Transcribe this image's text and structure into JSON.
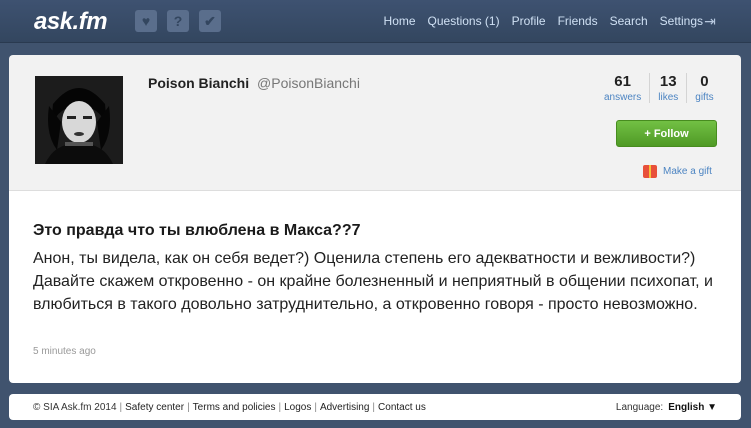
{
  "header": {
    "logo_text": "ask.fm",
    "icons": [
      "heart-icon",
      "question-icon",
      "check-icon"
    ],
    "nav": [
      "Home",
      "Questions (1)",
      "Profile",
      "Friends",
      "Search",
      "Settings"
    ],
    "logout_icon": "logout-icon"
  },
  "profile": {
    "name": "Poison Bianchi",
    "handle": "@PoisonBianchi",
    "stats": {
      "answers": {
        "value": "61",
        "label": "answers"
      },
      "likes": {
        "value": "13",
        "label": "likes"
      },
      "gifts": {
        "value": "0",
        "label": "gifts"
      }
    },
    "follow_label": "+ Follow",
    "gift_label": "Make a gift"
  },
  "post": {
    "question": "Это правда что ты влюблена в Макса??7",
    "answer": "Анон, ты видела, как он себя ведет?) Оценила степень его адекватности и вежливости?) Давайте скажем откровенно - он крайне болезненный и неприятный в общении психопат, и влюбиться в такого довольно затруднительно, а откровенно говоря - просто невозможно.",
    "time": "5 minutes ago"
  },
  "footer": {
    "copyright": "© SIA Ask.fm 2014",
    "links": [
      "Safety center",
      "Terms and policies",
      "Logos",
      "Advertising",
      "Contact us"
    ],
    "language_label": "Language:",
    "language_value": "English ▼"
  },
  "colors": {
    "background": "#40536e",
    "link": "#4c84c2",
    "follow_green": "#5aaa2e"
  }
}
